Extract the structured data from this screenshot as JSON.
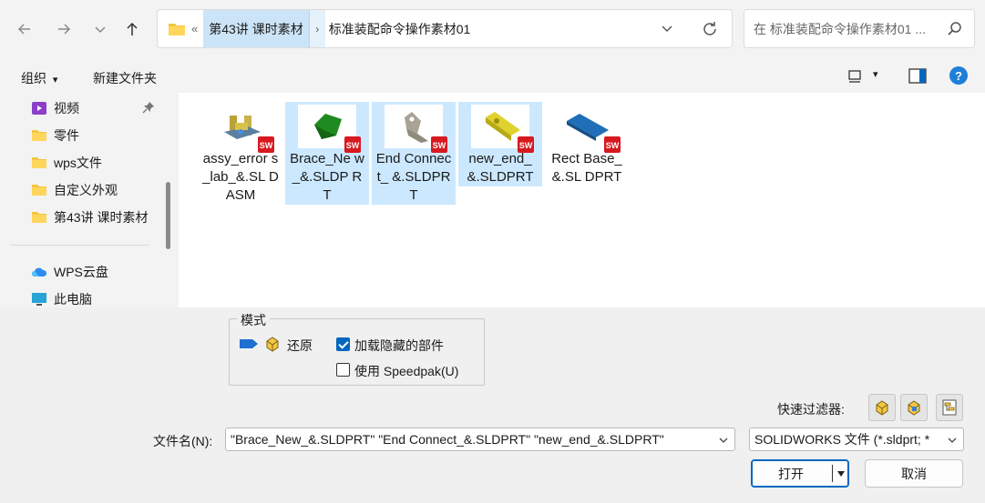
{
  "nav": {
    "back_icon": "arrow-left-icon",
    "forward_icon": "arrow-right-icon",
    "recent_icon": "chevron-down-icon",
    "up_icon": "arrow-up-icon"
  },
  "address": {
    "overflow": "«",
    "crumbs": [
      "第43讲 课时素材",
      "标准装配命令操作素材01"
    ],
    "separator": "›"
  },
  "search": {
    "placeholder": "在 标准装配命令操作素材01 ..."
  },
  "toolbar": {
    "organize": "组织",
    "organize_arrow": "▾",
    "new_folder": "新建文件夹",
    "view_arrow": "▾",
    "help": "?"
  },
  "sidebar": {
    "items": [
      {
        "label": "视频",
        "icon": "video-icon",
        "pinned": true
      },
      {
        "label": "零件",
        "icon": "folder-icon"
      },
      {
        "label": "wps文件",
        "icon": "folder-icon"
      },
      {
        "label": "自定义外观",
        "icon": "folder-icon"
      },
      {
        "label": "第43讲 课时素材",
        "icon": "folder-icon"
      },
      {
        "label": "WPS云盘",
        "icon": "cloud-icon"
      },
      {
        "label": "此电脑",
        "icon": "monitor-icon"
      }
    ]
  },
  "files": [
    {
      "name": "assy_error s_lab_&.SL DASM",
      "selected": false,
      "icon": "assembly-thumbnail"
    },
    {
      "name": "Brace_Ne w_&.SLDP RT",
      "selected": true,
      "icon": "green-part-thumbnail"
    },
    {
      "name": "End Connect_ &.SLDPRT",
      "selected": true,
      "icon": "gray-part-thumbnail"
    },
    {
      "name": "new_end_ &.SLDPRT",
      "selected": true,
      "icon": "yellow-part-thumbnail"
    },
    {
      "name": "Rect Base_&.SL DPRT",
      "selected": false,
      "icon": "blue-part-thumbnail"
    }
  ],
  "mode": {
    "title": "模式",
    "restore_label": "还原",
    "load_hidden_label": "加载隐藏的部件",
    "load_hidden_checked": true,
    "speedpak_label": "使用 Speedpak(U)",
    "speedpak_checked": false
  },
  "quick_filter": {
    "label": "快速过滤器:"
  },
  "filename": {
    "label": "文件名(N):",
    "value": "\"Brace_New_&.SLDPRT\" \"End Connect_&.SLDPRT\" \"new_end_&.SLDPRT\""
  },
  "filetype": {
    "value": "SOLIDWORKS 文件 (*.sldprt; *"
  },
  "buttons": {
    "open": "打开",
    "cancel": "取消"
  },
  "colors": {
    "accent": "#0067c0",
    "selection": "#cce8ff",
    "sw_red": "#d71920"
  }
}
